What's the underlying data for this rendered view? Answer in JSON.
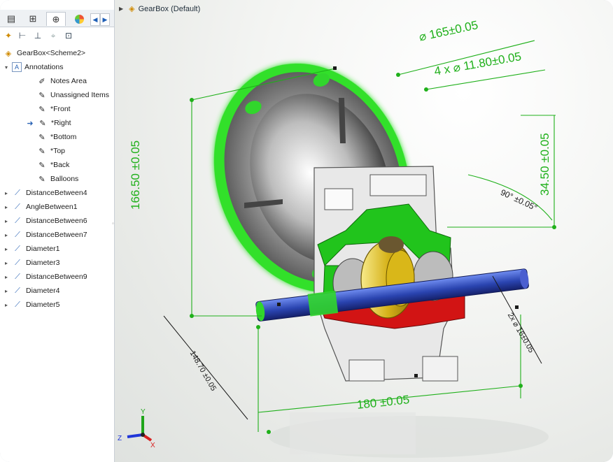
{
  "feature_tree": {
    "tabs": [
      "feature-manager",
      "property-manager",
      "dimxpert-manager",
      "display-manager"
    ],
    "root": "GearBox<Scheme2>",
    "annotations_label": "Annotations",
    "annotation_children": [
      "Notes Area",
      "Unassigned Items",
      "*Front",
      "*Right",
      "*Bottom",
      "*Top",
      "*Back",
      "Balloons"
    ],
    "dimensions": [
      "DistanceBetween4",
      "AngleBetween1",
      "DistanceBetween6",
      "DistanceBetween7",
      "Diameter1",
      "Diameter3",
      "DistanceBetween9",
      "Diameter4",
      "Diameter5"
    ]
  },
  "viewport": {
    "breadcrumb": "GearBox  (Default)",
    "dimensions": {
      "diameter_165": "⌀ 165±0.05",
      "holes": "4 x ⌀ 11.80±0.05",
      "height": "166.50 ±0.05",
      "offset": "34.50 ±0.05",
      "angle": "90° ±0.05°",
      "shaft_dia": "2x ⌀ 16±0.05",
      "depth": "148.70 ±0.05",
      "length": "180 ±0.05"
    },
    "triad_axes": [
      "Y",
      "Z",
      "X"
    ]
  },
  "colors": {
    "dimension_green": "#1fb01a",
    "highlight_green": "#31d62c",
    "section_red": "#d21414",
    "shaft_blue": "#3a5fd6"
  }
}
